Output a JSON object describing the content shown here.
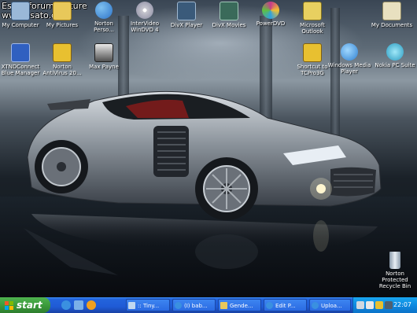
{
  "watermark": {
    "line1": "Esato forum picture",
    "line2": "www.esato.com"
  },
  "desktop_icons": [
    {
      "id": "my-computer",
      "label": "My Computer",
      "icon": "computer-icon",
      "color": "#9ab8d8"
    },
    {
      "id": "my-pictures",
      "label": "My Pictures",
      "icon": "folder-icon",
      "color": "#e8c85a"
    },
    {
      "id": "norton-personal",
      "label": "Norton\nPerso...",
      "icon": "globe-icon",
      "color": "#2e74c8"
    },
    {
      "id": "intervideo",
      "label": "InterVideo\nWinDVD 4",
      "icon": "dvd-icon",
      "color": "#c8c8d0"
    },
    {
      "id": "divx-player",
      "label": "DivX Player",
      "icon": "divx-icon",
      "color": "#3a5a7a"
    },
    {
      "id": "divx-movies",
      "label": "DivX Movies",
      "icon": "divx-icon",
      "color": "#3a6a5a"
    },
    {
      "id": "powerdvd",
      "label": "PowerDVD",
      "icon": "disc-icon",
      "color": "#c83a8a"
    },
    {
      "id": "outlook",
      "label": "Microsoft\nOutlook",
      "icon": "outlook-icon",
      "color": "#e8d060"
    },
    {
      "id": "my-documents",
      "label": "My Documents",
      "icon": "documents-icon",
      "color": "#e8e0c0"
    },
    {
      "id": "xtnd",
      "label": "XTNDConnect\nBlue Manager",
      "icon": "antenna-icon",
      "color": "#3060c0"
    },
    {
      "id": "norton-av",
      "label": "Norton\nAntiVirus 20...",
      "icon": "norton-icon",
      "color": "#e8c030"
    },
    {
      "id": "max-payne",
      "label": "Max Payne",
      "icon": "face-icon",
      "color": "#505050"
    },
    {
      "id": "tcpro",
      "label": "Shortcut to\nTCPro3G",
      "icon": "shortcut-icon",
      "color": "#e8c030"
    },
    {
      "id": "wmp",
      "label": "Windows Media\nPlayer",
      "icon": "media-player-icon",
      "color": "#3080d0"
    },
    {
      "id": "nokia",
      "label": "Nokia PC Suite",
      "icon": "nokia-icon",
      "color": "#2a9ac0"
    },
    {
      "id": "recycle-bin",
      "label": "Norton\nProtected\nRecycle Bin",
      "icon": "recycle-bin-icon",
      "color": "#c8d0d8"
    }
  ],
  "taskbar": {
    "start_label": "start",
    "quick_launch": [
      {
        "icon": "ie-icon",
        "color": "#3a90e0"
      },
      {
        "icon": "desktop-icon",
        "color": "#7ab0e8"
      },
      {
        "icon": "media-icon",
        "color": "#f0a020"
      }
    ],
    "tasks": [
      {
        "label": ":: Tiny...",
        "icon": "window-icon",
        "color": "#c0d8f0"
      },
      {
        "label": "(I) bab...",
        "icon": "ie-icon",
        "color": "#3a90e0"
      },
      {
        "label": "Gende...",
        "icon": "folder-icon",
        "color": "#e8c85a"
      },
      {
        "label": "Edit P...",
        "icon": "ie-icon",
        "color": "#3a90e0"
      },
      {
        "label": "Uploa...",
        "icon": "ie-icon",
        "color": "#3a90e0"
      }
    ],
    "tray_icons": [
      {
        "icon": "network-icon",
        "color": "#d0d8e0"
      },
      {
        "icon": "volume-icon",
        "color": "#e8e8e8"
      },
      {
        "icon": "antivirus-icon",
        "color": "#e8c030"
      },
      {
        "icon": "display-icon",
        "color": "#506070"
      }
    ],
    "clock": "22:07"
  },
  "colors": {
    "taskbar_blue": "#245edb",
    "start_green": "#3c9b3c",
    "tray_blue": "#0f8ae0"
  }
}
